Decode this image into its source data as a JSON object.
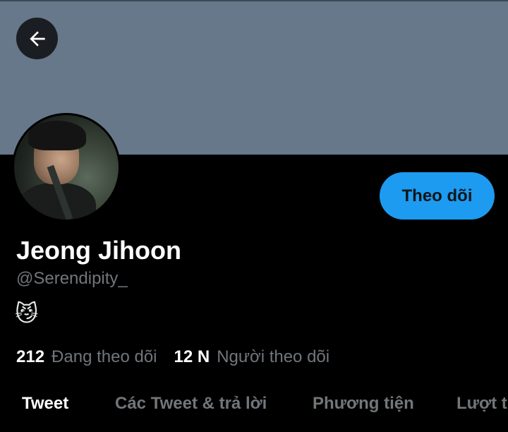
{
  "header": {
    "back_icon": "arrow-left-icon"
  },
  "profile": {
    "display_name": "Jeong Jihoon",
    "handle": "@Serendipity_",
    "bio": "😼",
    "follow_label": "Theo dõi"
  },
  "stats": {
    "following_count": "212",
    "following_label": "Đang theo dõi",
    "followers_count": "12 N",
    "followers_label": "Người theo dõi"
  },
  "tabs": [
    {
      "label": "Tweet",
      "active": true
    },
    {
      "label": "Các Tweet & trả lời",
      "active": false
    },
    {
      "label": "Phương tiện",
      "active": false
    },
    {
      "label": "Lượt thích",
      "active": false
    }
  ],
  "colors": {
    "banner": "#66788a",
    "accent": "#1d9bf0",
    "background": "#000000",
    "secondary_text": "#71767b"
  }
}
